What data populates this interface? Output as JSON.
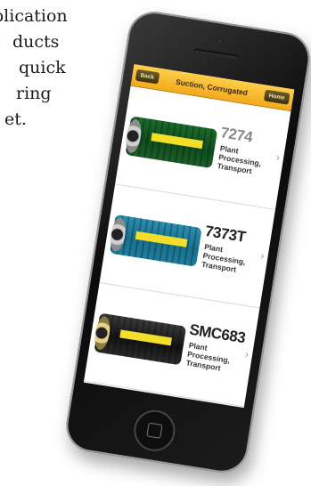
{
  "side_text": {
    "lines": [
      "plication",
      "ducts",
      "quick",
      "ring",
      "et."
    ]
  },
  "app": {
    "nav": {
      "back_label": "Back",
      "title": "Suction, Corrugated",
      "right_label": "Home"
    },
    "items": [
      {
        "code": "7274",
        "desc": [
          "Plant",
          "Processing,",
          "Transport"
        ],
        "hose_color": "#1b6b2c"
      },
      {
        "code": "7373T",
        "desc": [
          "Plant",
          "Processing,",
          "Transport"
        ],
        "hose_color": "#2c8fb0"
      },
      {
        "code": "SMC683",
        "desc": [
          "Plant",
          "Processing,",
          "Transport"
        ],
        "hose_color": "#2b2b2b"
      }
    ]
  },
  "colors": {
    "navbar_accent": "#f3a91a",
    "phone_body": "#0b0b0b"
  }
}
